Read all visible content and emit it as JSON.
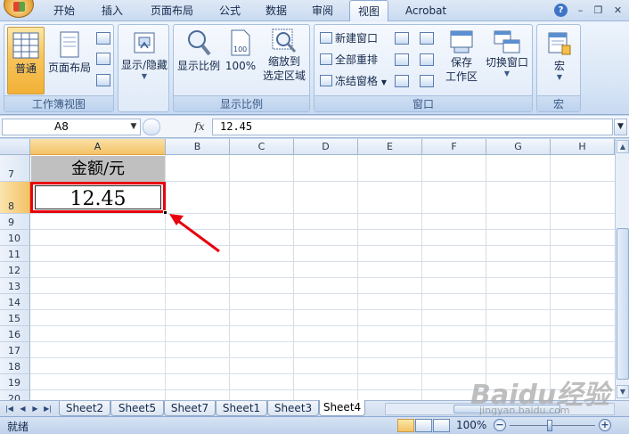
{
  "office_button": {
    "icon": "office-logo-icon"
  },
  "tabs": [
    {
      "label": "开始",
      "active": false
    },
    {
      "label": "插入",
      "active": false
    },
    {
      "label": "页面布局",
      "active": false
    },
    {
      "label": "公式",
      "active": false
    },
    {
      "label": "数据",
      "active": false
    },
    {
      "label": "审阅",
      "active": false
    },
    {
      "label": "视图",
      "active": true
    },
    {
      "label": "Acrobat",
      "active": false
    }
  ],
  "window_controls": {
    "help": "?",
    "minimize": "–",
    "restore": "❐",
    "close": "✕"
  },
  "ribbon": {
    "workbook_views": {
      "title": "工作簿视图",
      "normal": "普通",
      "page_layout": "页面布局"
    },
    "show_hide": {
      "label": "显示/隐藏"
    },
    "zoom": {
      "title": "显示比例",
      "zoom": "显示比例",
      "zoom100": "100%",
      "zoom_selection_line1": "缩放到",
      "zoom_selection_line2": "选定区域"
    },
    "window": {
      "title": "窗口",
      "new_window": "新建窗口",
      "arrange_all": "全部重排",
      "freeze_panes": "冻结窗格",
      "save_workspace_line1": "保存",
      "save_workspace_line2": "工作区",
      "switch_windows": "切换窗口"
    },
    "macros": {
      "title": "宏",
      "label": "宏"
    }
  },
  "formula_bar": {
    "name_box": "A8",
    "fx": "fx",
    "value": "12.45"
  },
  "grid": {
    "columns": [
      "A",
      "B",
      "C",
      "D",
      "E",
      "F",
      "G",
      "H"
    ],
    "selected_column": "A",
    "rows": [
      "7",
      "8",
      "9",
      "10",
      "11",
      "12",
      "13",
      "14",
      "15",
      "16",
      "17",
      "18",
      "19",
      "20"
    ],
    "selected_row": "8",
    "cells": {
      "A7": "金额/元",
      "A8": "12.45"
    },
    "colors": {
      "header_fill": "#c0c0c0",
      "selection_highlight": "#e8000c",
      "annotation_arrow": "#e8000c"
    }
  },
  "sheet_tabs": [
    {
      "label": "Sheet2",
      "active": false
    },
    {
      "label": "Sheet5",
      "active": false
    },
    {
      "label": "Sheet7",
      "active": false
    },
    {
      "label": "Sheet1",
      "active": false
    },
    {
      "label": "Sheet3",
      "active": false
    },
    {
      "label": "Sheet4",
      "active": true
    }
  ],
  "status_bar": {
    "status": "就绪",
    "zoom": "100%"
  },
  "watermark": {
    "logo": "Baidu经验",
    "url": "jingyan.baidu.com"
  }
}
